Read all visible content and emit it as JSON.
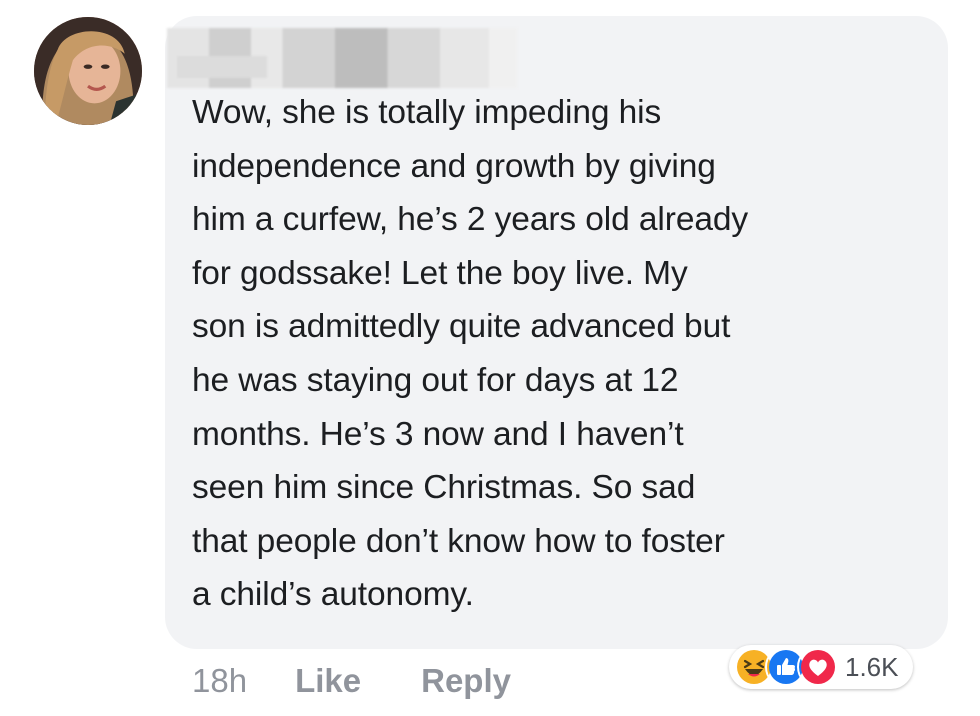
{
  "comment": {
    "text": "Wow, she is totally impeding his\nindependence and growth by giving\nhim a curfew, he’s 2 years old already\nfor godssake! Let the boy live. My\nson is admittedly quite advanced but\nhe was staying out for days at 12\nmonths. He’s 3 now and I haven’t\nseen him since Christmas. So sad\nthat people don’t know how to foster\na child’s autonomy.",
    "timestamp": "18h",
    "like_label": "Like",
    "reply_label": "Reply"
  },
  "reactions": {
    "icons": [
      "laughing-emoji-icon",
      "thumbs-up-icon",
      "heart-icon"
    ],
    "count": "1.6K"
  },
  "colors": {
    "bubble": "#f2f3f5",
    "text": "#1c1e21",
    "meta": "#90949c",
    "like_blue": "#1877f2",
    "love_red": "#f0284a",
    "haha_yellow": "#f7b125"
  }
}
